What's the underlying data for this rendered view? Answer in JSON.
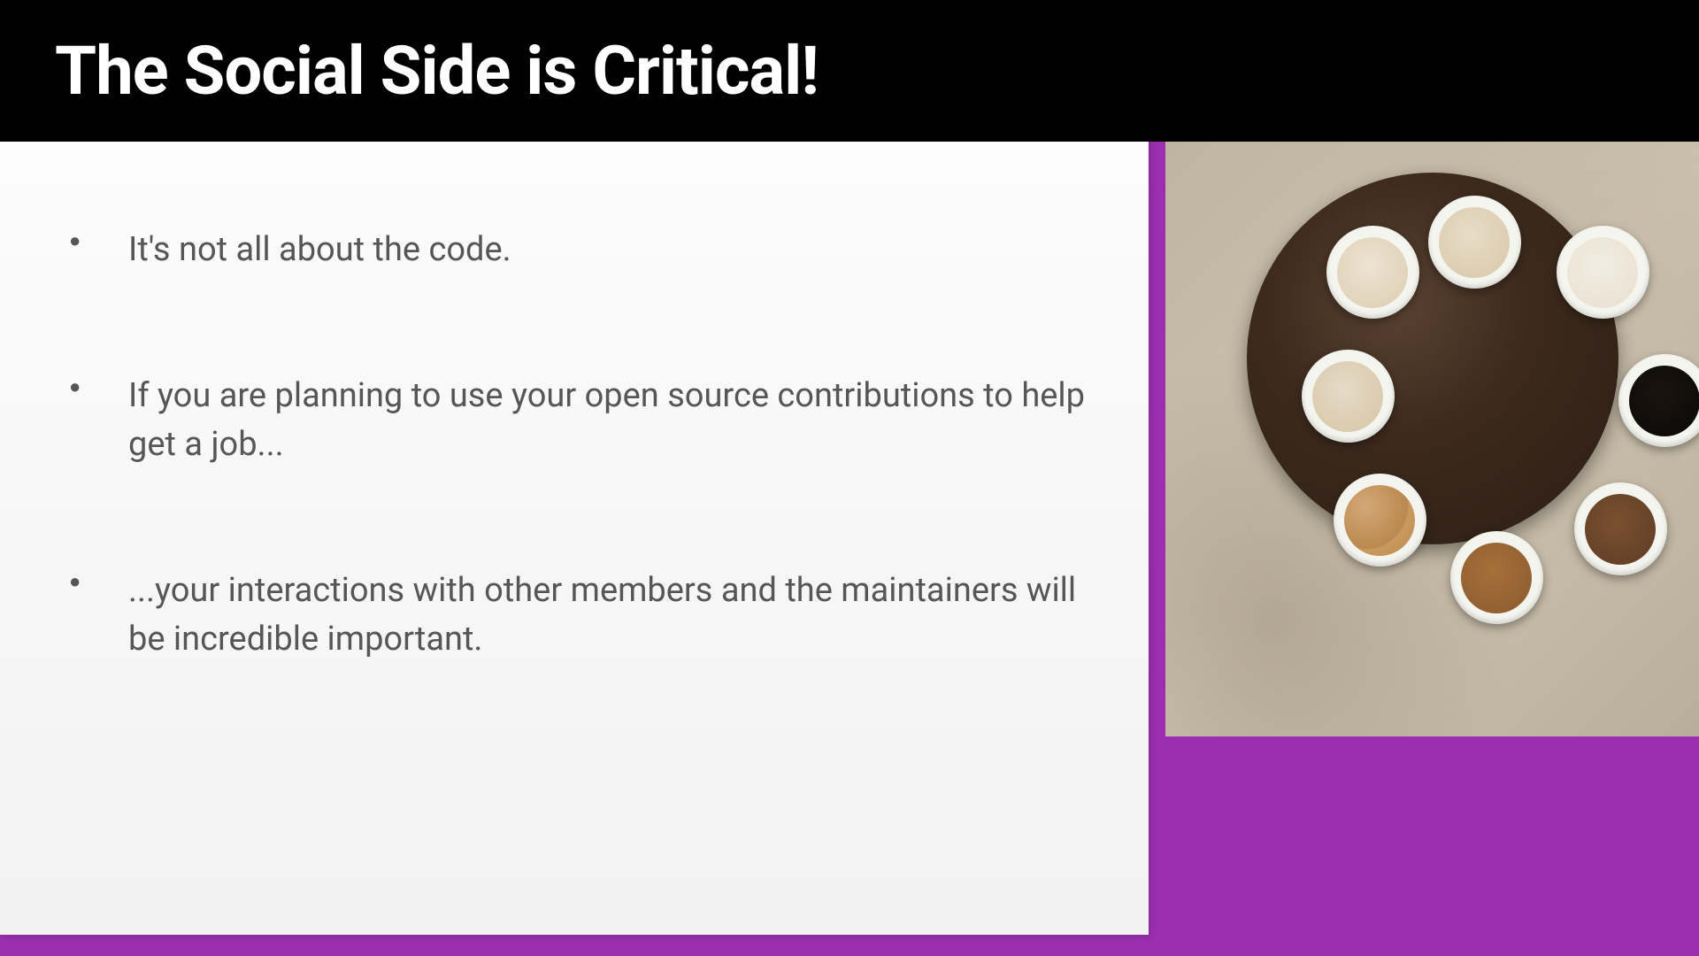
{
  "header": {
    "title": "The Social Side is Critical!"
  },
  "content": {
    "bullets": [
      "It's not all about the code.",
      "If you are planning to use your open source contributions to help get a job...",
      "...your interactions with other members and the maintainers will be incredible important."
    ]
  },
  "colors": {
    "accent": "#9b2fae",
    "header_bg": "#000000",
    "text": "#565656"
  },
  "image": {
    "description": "coffee-cups-on-round-table"
  }
}
